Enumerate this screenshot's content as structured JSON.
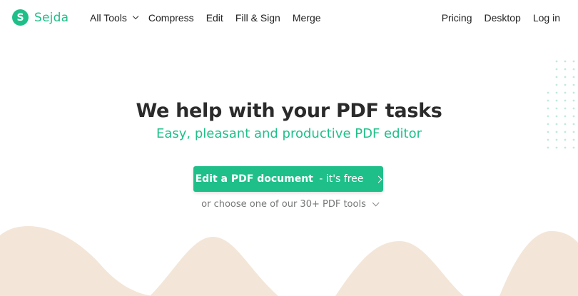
{
  "brand": {
    "logo_letter": "S",
    "name": "Sejda",
    "accent_color": "#1fbf8a"
  },
  "nav": {
    "left": [
      {
        "label": "All Tools",
        "has_dropdown": true
      },
      {
        "label": "Compress"
      },
      {
        "label": "Edit"
      },
      {
        "label": "Fill & Sign"
      },
      {
        "label": "Merge"
      }
    ],
    "right": [
      {
        "label": "Pricing"
      },
      {
        "label": "Desktop"
      },
      {
        "label": "Log in"
      }
    ]
  },
  "hero": {
    "title": "We help with your PDF tasks",
    "subtitle": "Easy, pleasant and productive PDF editor"
  },
  "cta": {
    "bold_label": "Edit a PDF document",
    "suffix": " - it's free",
    "icon": "chevron-right-icon"
  },
  "more_tools": {
    "label": "or choose one of our 30+ PDF tools",
    "icon": "chevron-down-icon"
  },
  "decor": {
    "wave_color": "#f3e6d8",
    "dots_color": "#bfeadb"
  }
}
